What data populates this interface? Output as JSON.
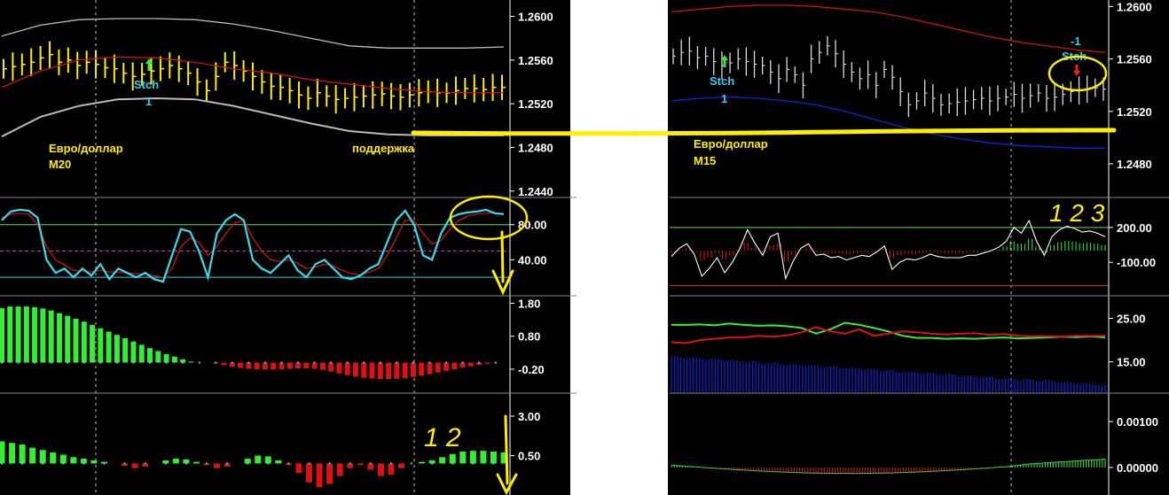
{
  "colors": {
    "background": "#000000",
    "axis": "#ffffff",
    "grid": "#bfbfbf",
    "yellow": "#ffee00",
    "cyan": "#33ddee",
    "red": "#dd1111",
    "green": "#33ee33",
    "blue": "#1122dd",
    "white": "#ffffff",
    "magenta": "#cc33cc",
    "hline_green": "#66dd66",
    "hline_cyan": "#33ccdd",
    "hline_red": "#dd2222"
  },
  "left": {
    "price": {
      "ticks": [
        "1.2600",
        "1.2560",
        "1.2520",
        "1.2480",
        "1.2440"
      ],
      "ylim": [
        1.2435,
        1.2615
      ],
      "labels": {
        "symbol": "Евро/доллар",
        "timeframe": "M20",
        "support": "поддержка",
        "stch": "Stch",
        "stch_num": "1"
      }
    },
    "stoch": {
      "ticks": [
        "80.00",
        "40.00"
      ],
      "ylim": [
        0,
        110
      ],
      "levels": [
        80,
        50,
        20
      ]
    },
    "osc1": {
      "ticks": [
        "1.80",
        "0.80",
        "-0.20"
      ],
      "ylim": [
        -0.9,
        2.0
      ]
    },
    "osc2": {
      "ticks": [
        "3.00",
        "0.50"
      ],
      "ylim": [
        -2.0,
        4.4
      ],
      "annotation": "1 2"
    }
  },
  "right": {
    "price": {
      "ticks": [
        "1.2600",
        "1.2560",
        "1.2520",
        "1.2480"
      ],
      "ylim": [
        1.2455,
        1.2605
      ],
      "labels": {
        "symbol": "Евро/доллар",
        "timeframe": "M15",
        "stch": "Stch",
        "stch_num": "1",
        "stch2": "Stch",
        "stch2_num": "-1"
      }
    },
    "cci": {
      "ticks": [
        "200.00",
        "-100.00"
      ],
      "ylim": [
        -380,
        450
      ],
      "annotation": "1 2 3"
    },
    "dmi": {
      "ticks": [
        "25.00",
        "15.00"
      ],
      "ylim": [
        8,
        30
      ]
    },
    "osc3": {
      "ticks": [
        "0.00100",
        "0.00000"
      ],
      "ylim": [
        -0.0006,
        0.0016
      ]
    }
  },
  "chart_data": [
    {
      "type": "line",
      "title": "Евро/доллар M20",
      "series": [
        {
          "values": [
            1.2552,
            1.2554,
            1.2556,
            1.2558,
            1.2562,
            1.2565,
            1.2558,
            1.256,
            1.2555,
            1.2558,
            1.2556,
            1.2553,
            1.2552,
            1.2548,
            1.2545,
            1.2547,
            1.255,
            1.2552,
            1.2555,
            1.2552,
            1.2548,
            1.254,
            1.2532,
            1.2545,
            1.2558,
            1.2555,
            1.255,
            1.2545,
            1.254,
            1.2536,
            1.2535,
            1.2532,
            1.2528,
            1.2525,
            1.253,
            1.2527,
            1.2524,
            1.2525,
            1.2526,
            1.2527,
            1.2528,
            1.2529,
            1.2527,
            1.2526,
            1.2528,
            1.253,
            1.2531,
            1.253,
            1.253,
            1.2532,
            1.2534,
            1.2534,
            1.2533,
            1.2535,
            1.2535
          ]
        },
        {
          "values": [
            1.2535,
            1.255,
            1.256,
            1.2563,
            1.2562,
            1.2558,
            1.2552,
            1.2548,
            1.2542,
            1.2538,
            1.2534,
            1.2531,
            1.253,
            1.253
          ]
        },
        {
          "values": [
            1.2582,
            1.2592,
            1.2597,
            1.2598,
            1.2598,
            1.2597,
            1.2593,
            1.2587,
            1.258,
            1.2573,
            1.2571,
            1.2571,
            1.2571,
            1.2572
          ]
        },
        {
          "values": [
            1.249,
            1.2508,
            1.2518,
            1.2524,
            1.2525,
            1.2524,
            1.2518,
            1.251,
            1.2502,
            1.2495,
            1.2492,
            1.2491,
            1.2491,
            1.2491
          ]
        }
      ]
    },
    {
      "type": "line",
      "series": [
        {
          "values": [
            85,
            95,
            97,
            96,
            88,
            40,
            25,
            30,
            20,
            30,
            22,
            35,
            18,
            30,
            25,
            20,
            25,
            18,
            15,
            45,
            75,
            72,
            50,
            20,
            70,
            85,
            92,
            85,
            40,
            30,
            25,
            35,
            45,
            28,
            20,
            35,
            40,
            30,
            20,
            18,
            22,
            30,
            35,
            60,
            85,
            96,
            80,
            45,
            40,
            70,
            88,
            92,
            94,
            95,
            97,
            93,
            92
          ]
        },
        {
          "values": [
            88,
            92,
            93,
            92,
            80,
            55,
            40,
            34,
            28,
            27,
            26,
            28,
            26,
            26,
            25,
            24,
            24,
            22,
            20,
            30,
            55,
            65,
            60,
            45,
            55,
            70,
            82,
            85,
            65,
            50,
            40,
            38,
            40,
            36,
            30,
            32,
            35,
            33,
            28,
            24,
            23,
            26,
            30,
            45,
            65,
            85,
            85,
            70,
            58,
            62,
            75,
            85,
            90,
            92,
            93,
            93,
            93
          ]
        }
      ]
    },
    {
      "type": "bar",
      "series": [
        {
          "values": [
            1.65,
            1.7,
            1.7,
            1.7,
            1.68,
            1.64,
            1.58,
            1.5,
            1.42,
            1.33,
            1.24,
            1.14,
            1.04,
            0.94,
            0.84,
            0.74,
            0.64,
            0.54,
            0.44,
            0.35,
            0.26,
            0.18,
            0.1,
            0.03,
            0.0,
            0.0,
            -0.03,
            -0.08,
            -0.13,
            -0.16,
            -0.19,
            -0.2,
            -0.21,
            -0.21,
            -0.2,
            -0.19,
            -0.18,
            -0.18,
            -0.19,
            -0.22,
            -0.27,
            -0.33,
            -0.38,
            -0.42,
            -0.46,
            -0.48,
            -0.5,
            -0.5,
            -0.49,
            -0.47,
            -0.44,
            -0.4,
            -0.35,
            -0.3,
            -0.25,
            -0.2,
            -0.15,
            -0.11,
            -0.07,
            -0.04,
            -0.02,
            0.0
          ]
        }
      ]
    },
    {
      "type": "bar",
      "series": [
        {
          "values": [
            1.4,
            1.3,
            1.2,
            1.0,
            0.85,
            0.7,
            0.55,
            0.4,
            0.3,
            0.2,
            0.1,
            0.0,
            -0.15,
            -0.3,
            -0.2,
            0.0,
            0.2,
            0.3,
            0.25,
            0.1,
            -0.1,
            -0.3,
            -0.2,
            0.0,
            0.3,
            0.5,
            0.45,
            0.2,
            -0.1,
            -0.6,
            -1.2,
            -1.5,
            -1.3,
            -0.8,
            -0.3,
            -0.1,
            -0.4,
            -0.8,
            -0.7,
            -0.3,
            0.0,
            0.1,
            0.2,
            0.4,
            0.6,
            0.75,
            0.8,
            0.8,
            0.75,
            0.7
          ]
        }
      ]
    },
    {
      "type": "line",
      "title": "Евро/доллар M15",
      "series": [
        {
          "values": [
            1.2562,
            1.2565,
            1.2566,
            1.2561,
            1.2562,
            1.2558,
            1.2555,
            1.2557,
            1.256,
            1.2558,
            1.2556,
            1.2555,
            1.255,
            1.2545,
            1.2552,
            1.2548,
            1.254,
            1.256,
            1.2565,
            1.257,
            1.2564,
            1.2556,
            1.255,
            1.2545,
            1.2548,
            1.254,
            1.2552,
            1.2546,
            1.2535,
            1.2525,
            1.2528,
            1.2534,
            1.253,
            1.2525,
            1.2526,
            1.2527,
            1.2528,
            1.2529,
            1.253,
            1.2528,
            1.253,
            1.2531,
            1.2533,
            1.253,
            1.2532,
            1.2534,
            1.253,
            1.2531,
            1.2533,
            1.2535,
            1.2536,
            1.2537,
            1.2538,
            1.2537
          ]
        },
        {
          "values": [
            1.2596,
            1.2598,
            1.26,
            1.2601,
            1.2601,
            1.26,
            1.2598,
            1.2596,
            1.2592,
            1.2587,
            1.2582,
            1.2577,
            1.2573,
            1.257,
            1.2567,
            1.2565
          ]
        },
        {
          "values": [
            1.2528,
            1.253,
            1.2531,
            1.253,
            1.2528,
            1.2525,
            1.252,
            1.2514,
            1.2508,
            1.2503,
            1.2499,
            1.2496,
            1.2494,
            1.2493,
            1.2492,
            1.2492
          ]
        }
      ]
    },
    {
      "type": "line",
      "series": [
        {
          "values": [
            -50,
            20,
            60,
            -30,
            -220,
            -150,
            -60,
            -190,
            -100,
            20,
            180,
            60,
            -40,
            120,
            150,
            -240,
            -90,
            20,
            60,
            -40,
            -30,
            -60,
            -50,
            -80,
            -60,
            -40,
            -50,
            -10,
            40,
            -160,
            -100,
            -70,
            -80,
            -60,
            -30,
            -50,
            -60,
            -60,
            -60,
            -40,
            -40,
            -20,
            0,
            30,
            80,
            200,
            150,
            260,
            80,
            -40,
            120,
            180,
            210,
            190,
            160,
            170,
            150,
            120
          ]
        }
      ]
    },
    {
      "type": "line",
      "series": [
        {
          "values": [
            23.5,
            23.5,
            23.6,
            23.4,
            23.8,
            23.5,
            23.3,
            23.4,
            23.2,
            22.8,
            21.5,
            22.5,
            24.0,
            23.5,
            22.8,
            22.0,
            21.0,
            20.5,
            20.5,
            20.3,
            20.4,
            20.3,
            20.5,
            20.6,
            20.4,
            20.5,
            20.6,
            20.8,
            20.7,
            20.9,
            20.6
          ]
        },
        {
          "values": [
            19.5,
            19.3,
            20.0,
            20.3,
            20.6,
            20.6,
            21.0,
            20.8,
            21.1,
            21.8,
            23.0,
            22.0,
            21.5,
            22.5,
            21.0,
            21.5,
            22.0,
            21.8,
            21.5,
            21.3,
            21.5,
            21.6,
            21.2,
            21.4,
            21.0,
            20.9,
            20.9,
            20.8,
            21.0,
            21.0,
            21.0
          ]
        }
      ]
    }
  ]
}
